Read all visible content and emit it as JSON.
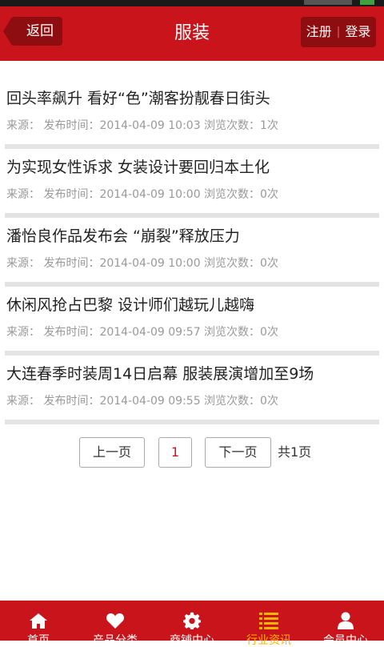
{
  "header": {
    "back_label": "返回",
    "title": "服装",
    "register_label": "注册",
    "separator": "|",
    "login_label": "登录"
  },
  "articles": [
    {
      "title": "回头率飙升 看好“色”潮客扮靓春日街头",
      "meta": "来源： 发布时间：2014-04-09 10:03 浏览次数：1次"
    },
    {
      "title": "为实现女性诉求 女装设计要回归本土化",
      "meta": "来源： 发布时间：2014-04-09 10:00 浏览次数：0次"
    },
    {
      "title": "潘怡良作品发布会 “崩裂”释放压力",
      "meta": "来源： 发布时间：2014-04-09 10:00 浏览次数：0次"
    },
    {
      "title": "休闲风抢占巴黎 设计师们越玩儿越嗨",
      "meta": "来源： 发布时间：2014-04-09 09:57 浏览次数：0次"
    },
    {
      "title": "大连春季时装周14日启幕 服装展演增加至9场",
      "meta": "来源： 发布时间：2014-04-09 09:55 浏览次数：0次"
    }
  ],
  "pagination": {
    "prev_label": "上一页",
    "current_page": "1",
    "next_label": "下一页",
    "total_label": "共1页"
  },
  "tabbar": {
    "items": [
      {
        "label": "首页",
        "icon": "home-icon"
      },
      {
        "label": "产品分类",
        "icon": "heart-icon"
      },
      {
        "label": "商铺中心",
        "icon": "gear-icon"
      },
      {
        "label": "行业资讯",
        "icon": "list-icon",
        "active": true
      },
      {
        "label": "会员中心",
        "icon": "user-icon"
      }
    ]
  },
  "colors": {
    "brand_red": "#c8141a",
    "dark_red": "#8e0d11",
    "active_tab": "#ffb400"
  }
}
